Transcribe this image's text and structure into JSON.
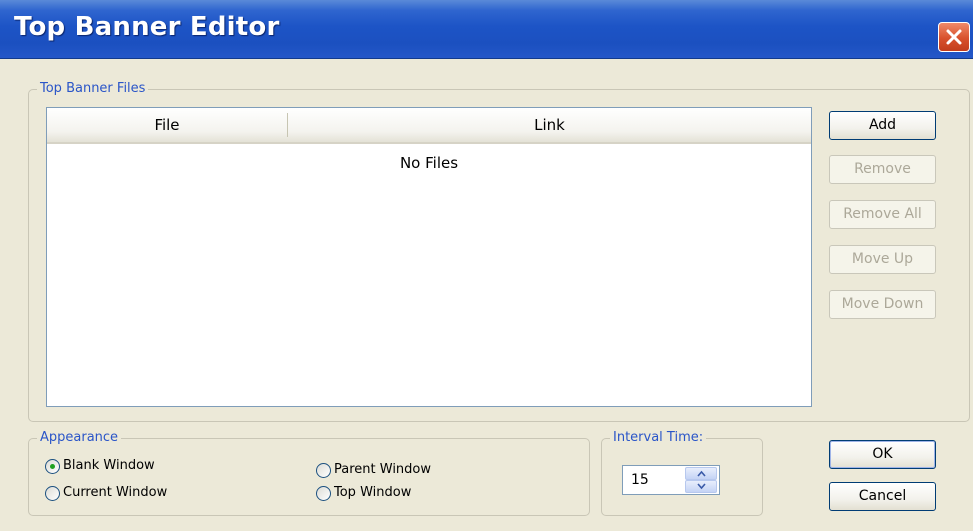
{
  "window": {
    "title": "Top Banner Editor",
    "close_icon": "close-icon"
  },
  "files_group": {
    "legend": "Top Banner Files",
    "columns": [
      "File",
      "Link"
    ],
    "empty_text": "No Files"
  },
  "buttons": {
    "add": "Add",
    "remove": "Remove",
    "remove_all": "Remove All",
    "move_up": "Move Up",
    "move_down": "Move Down",
    "ok": "OK",
    "cancel": "Cancel"
  },
  "appearance": {
    "legend": "Appearance",
    "options": [
      {
        "label": "Blank Window",
        "selected": true
      },
      {
        "label": "Current Window",
        "selected": false
      },
      {
        "label": "Parent Window",
        "selected": false
      },
      {
        "label": "Top Window",
        "selected": false
      }
    ]
  },
  "interval": {
    "legend": "Interval Time:",
    "value": "15"
  },
  "colors": {
    "titlebar": "#1d54c6",
    "legend_text": "#2a55c8",
    "dialog_bg": "#ece9d8",
    "radio_selected": "#21a121"
  }
}
